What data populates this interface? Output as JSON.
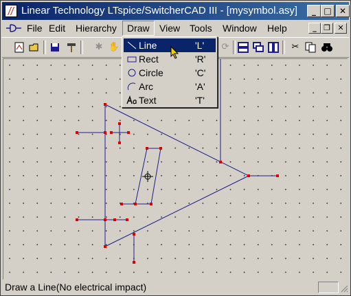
{
  "window": {
    "title": "Linear Technology LTspice/SwitcherCAD III - [mysymbol.asy]"
  },
  "title_buttons": {
    "minimize": "_",
    "maximize": "□",
    "close": "✕"
  },
  "menubar": {
    "items": [
      "File",
      "Edit",
      "Hierarchy",
      "Draw",
      "View",
      "Tools",
      "Window",
      "Help"
    ],
    "active": "Draw"
  },
  "mdi_buttons": {
    "minimize": "_",
    "restore": "❐",
    "close": "✕"
  },
  "toolbar": {
    "tools": [
      "new-schematic-icon",
      "open-icon",
      "save-icon",
      "hammer-icon",
      "move-icon",
      "drag-icon",
      "rotate-icon",
      "align-icon",
      "tile-horizontal-icon",
      "cascade-icon",
      "tile-vertical-icon",
      "cut-icon",
      "copy-icon",
      "find-icon"
    ]
  },
  "draw_menu": {
    "items": [
      {
        "label": "Line",
        "shortcut": "'L'",
        "icon": "line-icon"
      },
      {
        "label": "Rect",
        "shortcut": "'R'",
        "icon": "rect-icon"
      },
      {
        "label": "Circle",
        "shortcut": "'C'",
        "icon": "circle-icon"
      },
      {
        "label": "Arc",
        "shortcut": "'A'",
        "icon": "arc-icon"
      },
      {
        "label": "Text",
        "shortcut": "'T'",
        "icon": "text-icon"
      }
    ],
    "selected": "Line"
  },
  "status": {
    "text": "Draw a Line(No electrical impact)"
  },
  "colors": {
    "title_start": "#0a246a",
    "title_end": "#3a6ea5",
    "line": "#1c1c8c",
    "handle": "#e00000",
    "menu_select": "#0a246a"
  }
}
